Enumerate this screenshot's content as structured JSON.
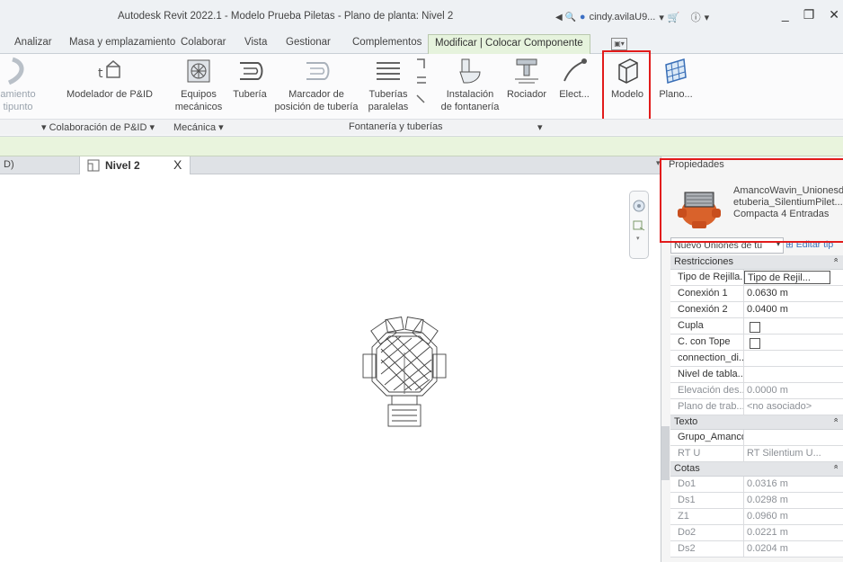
{
  "window": {
    "title": "Autodesk Revit 2022.1 - Modelo Prueba Piletas - Plano de planta: Nivel 2",
    "user": "cindy.avilaU9...",
    "controls": [
      "_",
      "❐",
      "✕"
    ]
  },
  "ribbon_tabs": [
    {
      "label": "Analizar"
    },
    {
      "label": "Masa y emplazamiento"
    },
    {
      "label": "Colaborar"
    },
    {
      "label": "Vista"
    },
    {
      "label": "Gestionar"
    },
    {
      "label": "Complementos"
    },
    {
      "label": "Modificar | Colocar Componente"
    }
  ],
  "ribbon_buttons": {
    "punto": {
      "l1": "amiento",
      "l2": "tipunto"
    },
    "pid": {
      "l1": "Modelador de P&ID"
    },
    "equipos": {
      "l1": "Equipos",
      "l2": "mecánicos"
    },
    "tuberia": {
      "l1": "Tubería"
    },
    "marcador": {
      "l1": "Marcador de",
      "l2": "posición de tubería"
    },
    "paralelas": {
      "l1": "Tuberías",
      "l2": "paralelas"
    },
    "instalacion": {
      "l1": "Instalación",
      "l2": "de fontanería"
    },
    "rociador": {
      "l1": "Rociador"
    },
    "elect": {
      "l1": "Elect..."
    },
    "modelo": {
      "l1": "Modelo"
    },
    "plano": {
      "l1": "Plano..."
    }
  },
  "panel_labels": {
    "p1": "Colaboración de P&ID",
    "p2": "Mecánica",
    "p3": "Fontanería y tuberías"
  },
  "view": {
    "left_tab": "D)",
    "active_tab": "Nivel 2",
    "close": "X"
  },
  "properties": {
    "title": "Propiedades",
    "type_name": [
      "AmancoWavin_Unionesd",
      "etuberia_SilentiumPilet...",
      "Compacta 4 Entradas"
    ],
    "selector": "Nuevo Uniones de tu",
    "edit_type": "Editar tip",
    "groups": [
      {
        "name": "Restricciones",
        "rows": [
          {
            "name": "Tipo de Rejilla...",
            "value": "Tipo de Rejil...",
            "kind": "input"
          },
          {
            "name": "Conexión 1",
            "value": "0.0630 m"
          },
          {
            "name": "Conexión 2",
            "value": "0.0400 m"
          },
          {
            "name": "Cupla",
            "value": "",
            "kind": "check"
          },
          {
            "name": "C. con Tope",
            "value": "",
            "kind": "check"
          },
          {
            "name": "connection_di...",
            "value": ""
          },
          {
            "name": "Nivel de tabla...",
            "value": ""
          },
          {
            "name": "Elevación des...",
            "value": "0.0000 m",
            "dim": true
          },
          {
            "name": "Plano de trab...",
            "value": "<no asociado>",
            "dim": true
          }
        ]
      },
      {
        "name": "Texto",
        "rows": [
          {
            "name": "Grupo_Amanco",
            "value": ""
          },
          {
            "name": "RT U",
            "value": "RT Silentium U...",
            "dim": true
          }
        ]
      },
      {
        "name": "Cotas",
        "rows": [
          {
            "name": "Do1",
            "value": "0.0316 m",
            "dim": true
          },
          {
            "name": "Ds1",
            "value": "0.0298 m",
            "dim": true
          },
          {
            "name": "Z1",
            "value": "0.0960 m",
            "dim": true
          },
          {
            "name": "Do2",
            "value": "0.0221 m",
            "dim": true
          },
          {
            "name": "Ds2",
            "value": "0.0204 m",
            "dim": true
          }
        ]
      }
    ]
  },
  "colors": {
    "highlight": "#e21b1b",
    "options_bar": "#e9f4dd",
    "active_tab": "#e6f3dd"
  }
}
